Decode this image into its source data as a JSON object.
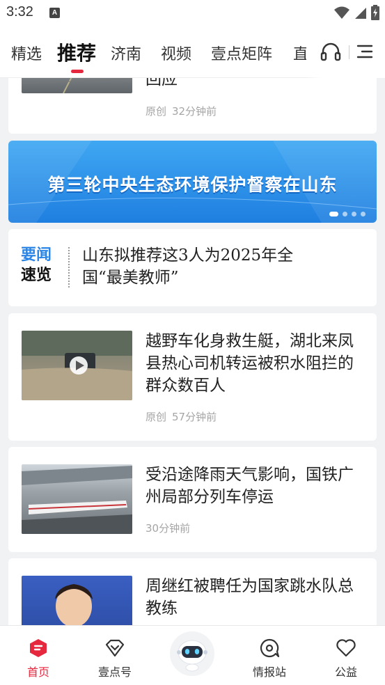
{
  "status": {
    "time": "3:32",
    "a_icon": "A"
  },
  "nav": {
    "tabs": [
      {
        "label": "精选"
      },
      {
        "label": "推荐"
      },
      {
        "label": "济南"
      },
      {
        "label": "视频"
      },
      {
        "label": "壹点矩阵"
      },
      {
        "label": "直"
      }
    ],
    "active_tab": "推荐",
    "accent_color": "#e6283f"
  },
  "feed": {
    "partial_card": {
      "title": "回应",
      "source": "原创",
      "time": "32分钟前"
    },
    "banner": {
      "text": "第三轮中央生态环境保护督察在山东",
      "slides": 4,
      "active_slide": 1
    },
    "brief": {
      "label_line1": "要闻",
      "label_line2": "速览",
      "text": "山东拟推荐这3人为2025年全国“最美教师”"
    },
    "articles": [
      {
        "title": "越野车化身救生艇，湖北来凤县热心司机转运被积水阻拦的群众数百人",
        "source": "原创",
        "time": "57分钟前",
        "has_video": true
      },
      {
        "title": "受沿途降雨天气影响，国铁广州局部分列车停运",
        "source": "",
        "time": "30分钟前",
        "has_video": false
      },
      {
        "title": "周继红被聘任为国家跳水队总教练",
        "source": "",
        "time": "",
        "has_video": false
      }
    ]
  },
  "bottom_nav": {
    "items": [
      {
        "label": "首页",
        "icon": "home-icon"
      },
      {
        "label": "壹点号",
        "icon": "heart-shield-icon"
      },
      {
        "label": "",
        "icon": "robot-icon"
      },
      {
        "label": "情报站",
        "icon": "chat-eye-icon"
      },
      {
        "label": "公益",
        "icon": "heart-icon"
      }
    ]
  }
}
